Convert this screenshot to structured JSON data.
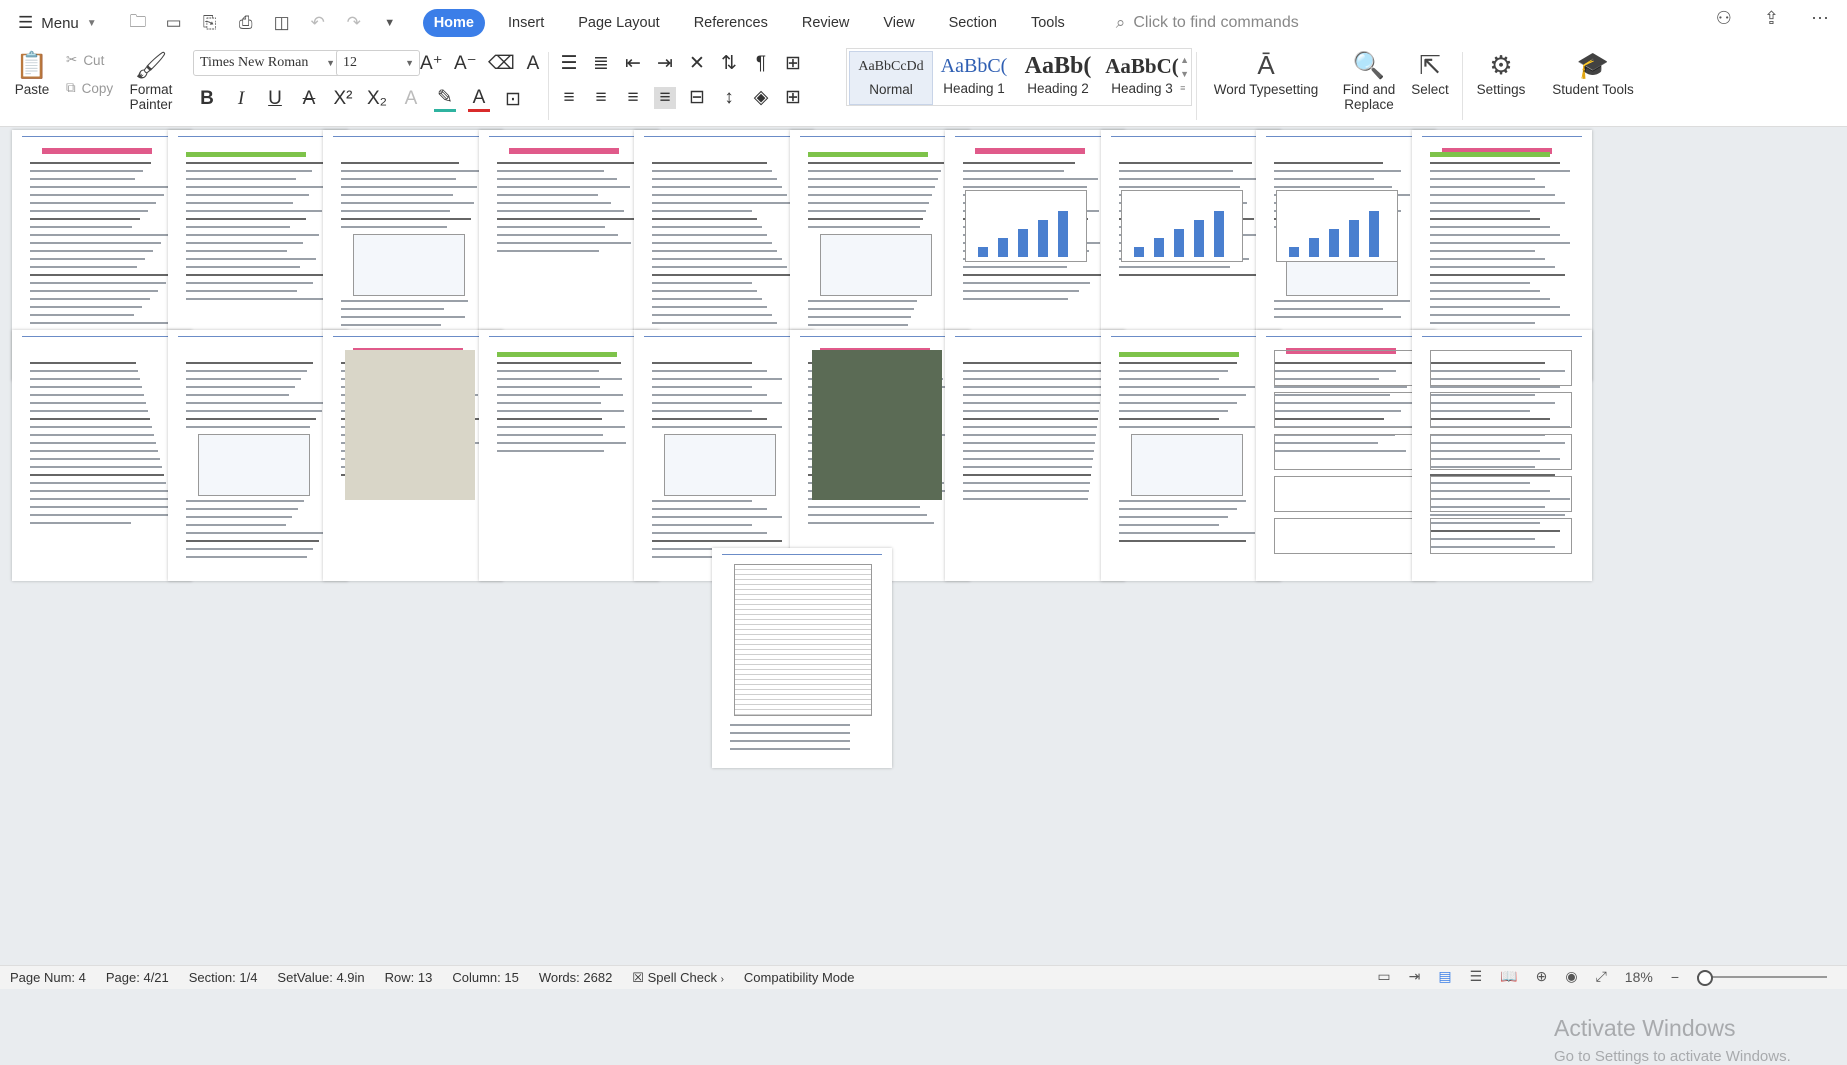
{
  "menubar": {
    "menu_label": "Menu",
    "tabs": [
      {
        "label": "Home",
        "active": true
      },
      {
        "label": "Insert"
      },
      {
        "label": "Page Layout"
      },
      {
        "label": "References"
      },
      {
        "label": "Review"
      },
      {
        "label": "View"
      },
      {
        "label": "Section"
      },
      {
        "label": "Tools"
      }
    ],
    "find_commands": "Click to find commands"
  },
  "ribbon": {
    "paste": "Paste",
    "cut": "Cut",
    "copy": "Copy",
    "format_painter_1": "Format",
    "format_painter_2": "Painter",
    "font_name": "Times New Roman",
    "font_size": "12",
    "styles": [
      {
        "preview": "AaBbCcDd",
        "label": "Normal"
      },
      {
        "preview": "AaBbC(",
        "label": "Heading 1"
      },
      {
        "preview": "AaBb(",
        "label": "Heading 2"
      },
      {
        "preview": "AaBbC(",
        "label": "Heading 3"
      }
    ],
    "word_typesetting": "Word Typesetting",
    "find_replace_1": "Find and",
    "find_replace_2": "Replace",
    "select": "Select",
    "settings": "Settings",
    "student_tools": "Student Tools"
  },
  "watermark": {
    "line1": "Activate Windows",
    "line2": "Go to Settings to activate Windows."
  },
  "status": {
    "page_num": "Page Num: 4",
    "page": "Page: 4/21",
    "section": "Section: 1/4",
    "set_value": "SetValue: 4.9in",
    "row": "Row: 13",
    "column": "Column: 15",
    "words": "Words: 2682",
    "spell_check": "Spell Check",
    "compat": "Compatibility Mode",
    "zoom": "18%"
  },
  "colors": {
    "accent": "#3b7ee8",
    "heading_blue": "#2f5fb3",
    "pink_bar": "#e05a8a",
    "green_bar": "#7ec34a"
  }
}
